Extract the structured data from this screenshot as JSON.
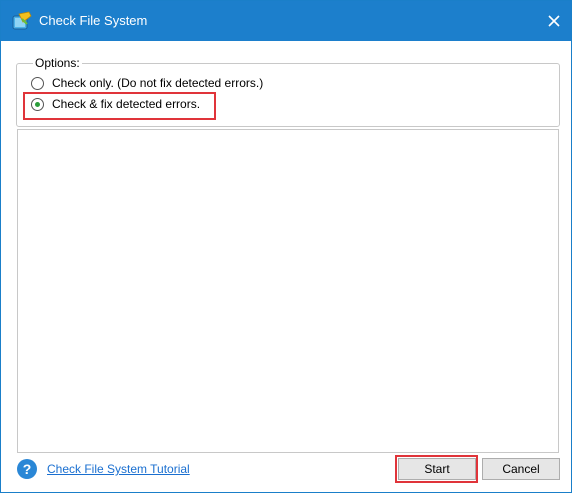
{
  "window": {
    "title": "Check File System",
    "accent_color": "#1c7fcc"
  },
  "options": {
    "legend": "Options:",
    "items": [
      {
        "label": "Check only. (Do not fix detected errors.)",
        "selected": false
      },
      {
        "label": "Check & fix detected errors.",
        "selected": true
      }
    ]
  },
  "footer": {
    "help_icon_glyph": "?",
    "tutorial_link": "Check File System Tutorial",
    "start_label": "Start",
    "cancel_label": "Cancel"
  },
  "icons": {
    "app": "check-file-system-app-icon",
    "close": "close-icon",
    "help": "help-icon"
  },
  "highlight_color": "#e0343a"
}
